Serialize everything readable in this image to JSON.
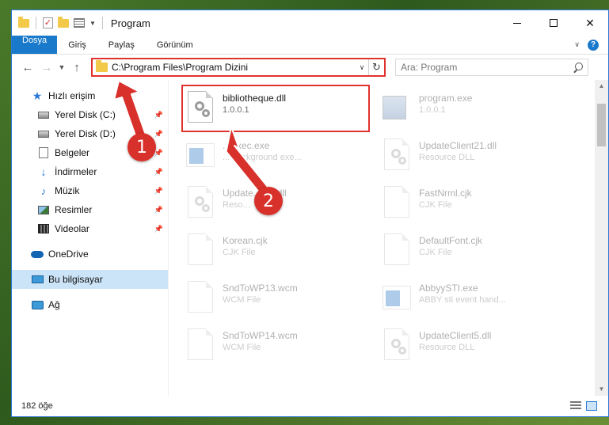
{
  "window": {
    "title": "Program"
  },
  "ribbon": {
    "tabs": [
      "Dosya",
      "Giriş",
      "Paylaş",
      "Görünüm"
    ]
  },
  "address": {
    "path": "C:\\Program Files\\Program Dizini",
    "search_placeholder": "Ara: Program"
  },
  "nav": {
    "quick_access": "Hızlı erişim",
    "items": [
      {
        "label": "Yerel Disk (C:)",
        "icon": "drive-icon"
      },
      {
        "label": "Yerel Disk (D:)",
        "icon": "drive-icon"
      },
      {
        "label": "Belgeler",
        "icon": "documents-icon"
      },
      {
        "label": "İndirmeler",
        "icon": "downloads-icon"
      },
      {
        "label": "Müzik",
        "icon": "music-icon"
      },
      {
        "label": "Resimler",
        "icon": "pictures-icon"
      },
      {
        "label": "Videolar",
        "icon": "videos-icon"
      }
    ],
    "onedrive": "OneDrive",
    "this_pc": "Bu bilgisayar",
    "network": "Ağ"
  },
  "files": [
    {
      "name": "bibliotheque.dll",
      "sub": "1.0.0.1",
      "icon": "dll-file-icon"
    },
    {
      "name": "program.exe",
      "sub": "1.0.0.1",
      "icon": "program-exe-icon"
    },
    {
      "name": "...Exec.exe",
      "sub": "... background exe...",
      "icon": "exe-file-icon"
    },
    {
      "name": "UpdateClient21.dll",
      "sub": "Resource DLL",
      "icon": "dll-file-icon"
    },
    {
      "name": "Update...t21.dll",
      "sub": "Reso...",
      "icon": "dll-file-icon"
    },
    {
      "name": "FastNrml.cjk",
      "sub": "CJK File",
      "icon": "file-icon"
    },
    {
      "name": "Korean.cjk",
      "sub": "CJK File",
      "icon": "file-icon"
    },
    {
      "name": "DefaultFont.cjk",
      "sub": "CJK File",
      "icon": "file-icon"
    },
    {
      "name": "SndToWP13.wcm",
      "sub": "WCM File",
      "icon": "file-icon"
    },
    {
      "name": "AbbyySTI.exe",
      "sub": "ABBY sti event hand...",
      "icon": "exe-file-icon"
    },
    {
      "name": "SndToWP14.wcm",
      "sub": "WCM File",
      "icon": "file-icon"
    },
    {
      "name": "UpdateClient5.dll",
      "sub": "Resource DLL",
      "icon": "dll-file-icon"
    }
  ],
  "status": {
    "count": "182 öğe"
  },
  "annotations": {
    "badge1": "1",
    "badge2": "2",
    "color": "#d8302b"
  }
}
